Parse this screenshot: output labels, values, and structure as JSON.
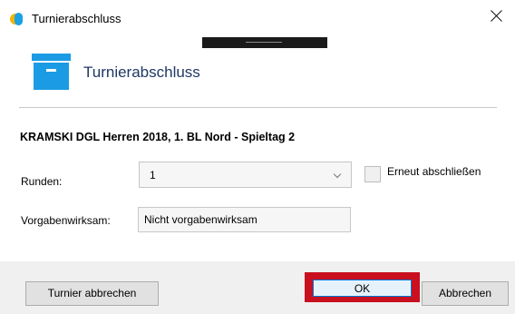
{
  "window": {
    "title": "Turnierabschluss"
  },
  "header": {
    "title": "Turnierabschluss",
    "icon": "archive-box-icon",
    "accent_color": "#1b9be3"
  },
  "tournament": {
    "name": "KRAMSKI DGL Herren 2018, 1. BL Nord - Spieltag 2"
  },
  "form": {
    "runden_label": "Runden:",
    "runden_value": "1",
    "reclose_label": "Erneut abschließen",
    "reclose_checked": false,
    "vorgabe_label": "Vorgabenwirksam:",
    "vorgabe_value": "Nicht vorgabenwirksam"
  },
  "buttons": {
    "abort_label": "Turnier abbrechen",
    "ok_label": "OK",
    "cancel_label": "Abbrechen",
    "highlight_color": "#c8101e"
  }
}
